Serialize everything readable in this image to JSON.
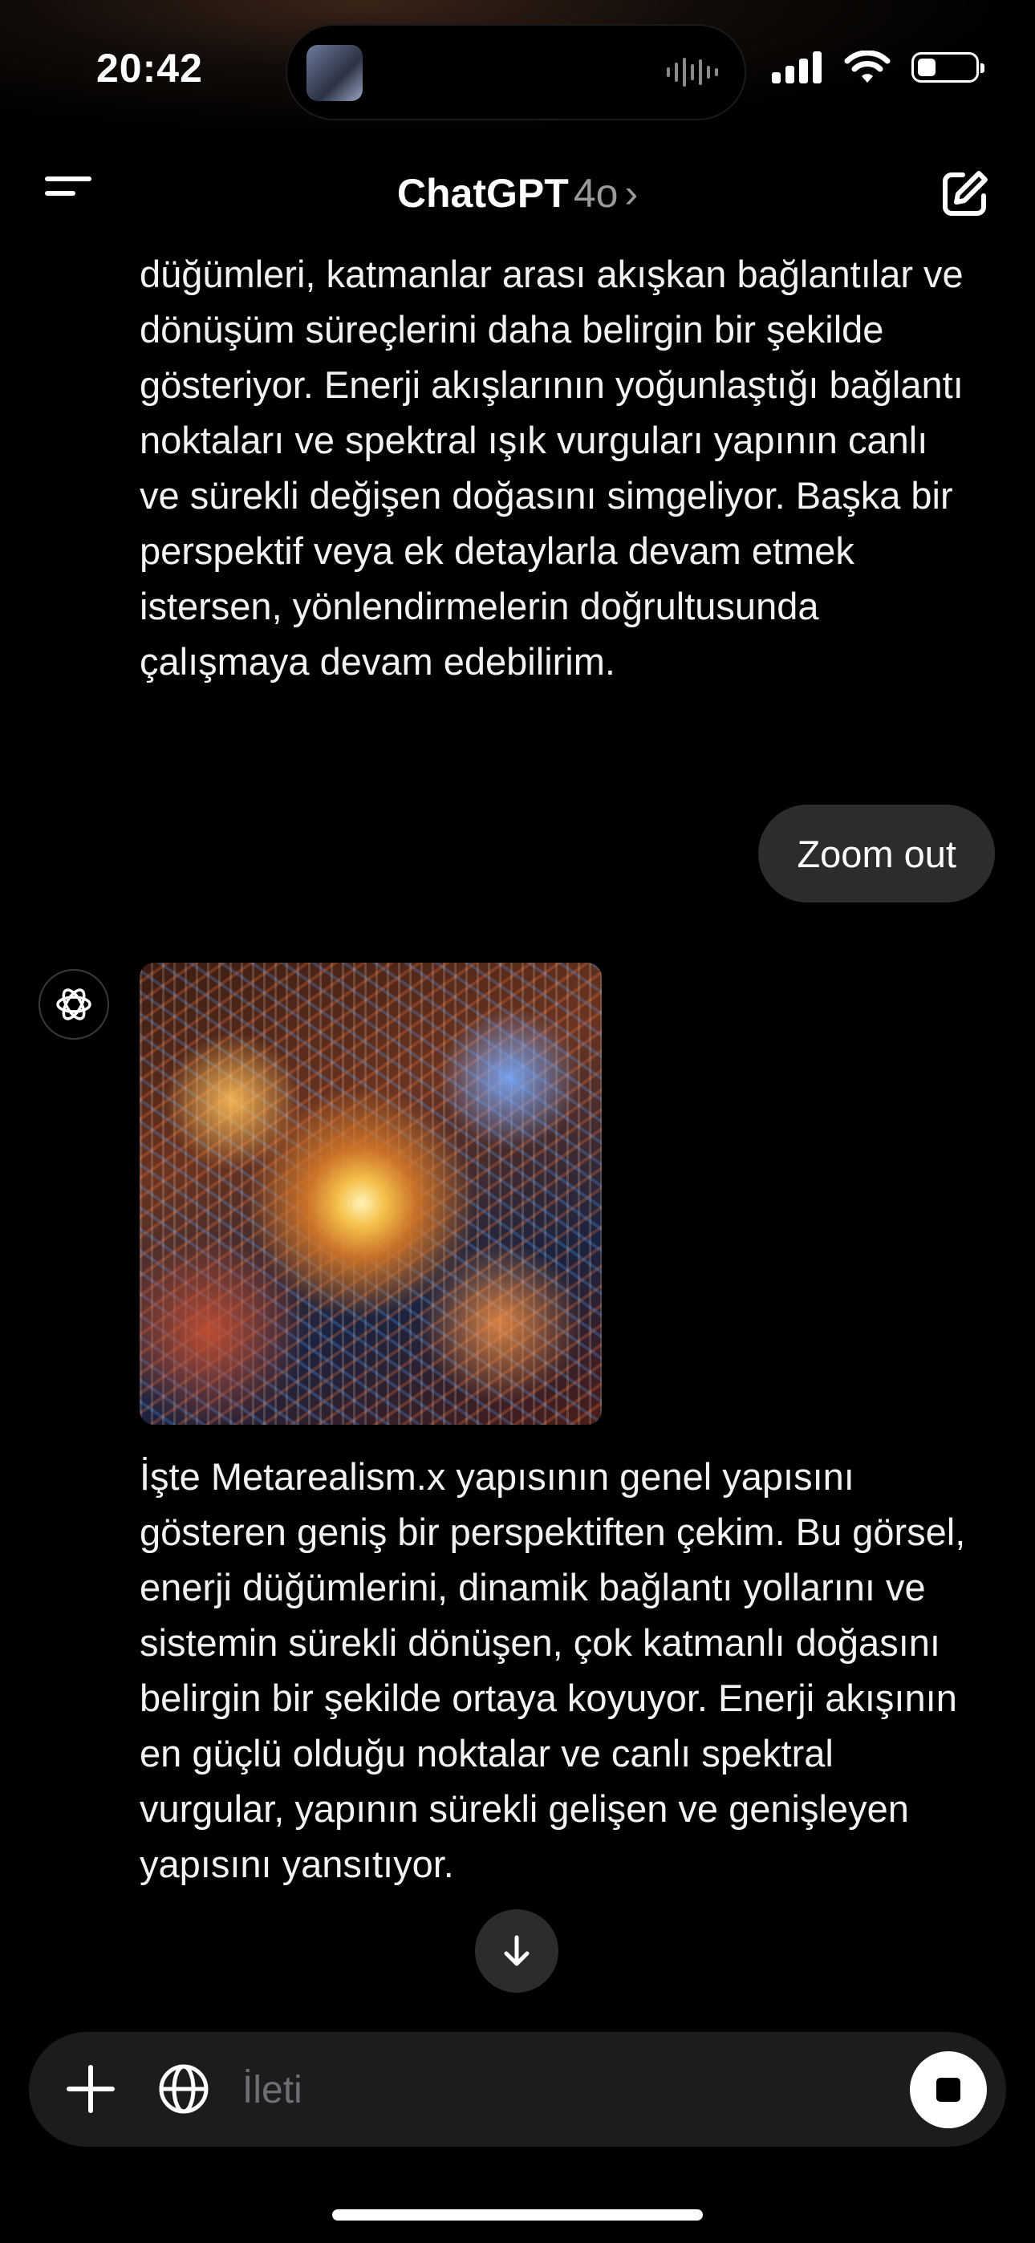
{
  "status_bar": {
    "time": "20:42"
  },
  "header": {
    "title": "ChatGPT",
    "model": "4o",
    "chevron": "›"
  },
  "messages": {
    "assistant_1_text": "düğümleri, katmanlar arası akışkan bağlantılar ve dönüşüm süreçlerini daha belirgin bir şekilde gösteriyor. Enerji akışlarının yoğunlaştığı bağlantı noktaları ve spektral ışık vurguları yapının canlı ve sürekli değişen doğasını simgeliyor. Başka bir perspektif veya ek detaylarla devam etmek istersen, yönlendirmelerin doğrultusunda çalışmaya devam edebilirim.",
    "user_1_text": "Zoom out",
    "assistant_2_text": "İşte Metarealism.x yapısının genel yapısını gösteren geniş bir perspektiften çekim. Bu görsel, enerji düğümlerini, dinamik bağlantı yollarını ve sistemin sürekli dönüşen, çok katmanlı doğasını belirgin bir şekilde ortaya koyuyor. Enerji akışının en güçlü olduğu noktalar ve canlı spektral vurgular, yapının sürekli gelişen ve genişleyen yapısını yansıtıyor."
  },
  "composer": {
    "placeholder": "İleti"
  },
  "icons": {
    "menu": "menu-icon",
    "compose": "compose-icon",
    "avatar": "chatgpt-logo-icon",
    "scroll": "arrow-down-icon",
    "plus": "plus-icon",
    "globe": "globe-icon",
    "stop": "stop-icon"
  },
  "colors": {
    "background": "#000000",
    "bubble": "#2c2c2e",
    "composer": "#1c1c1e",
    "muted": "#9a9a9a"
  }
}
